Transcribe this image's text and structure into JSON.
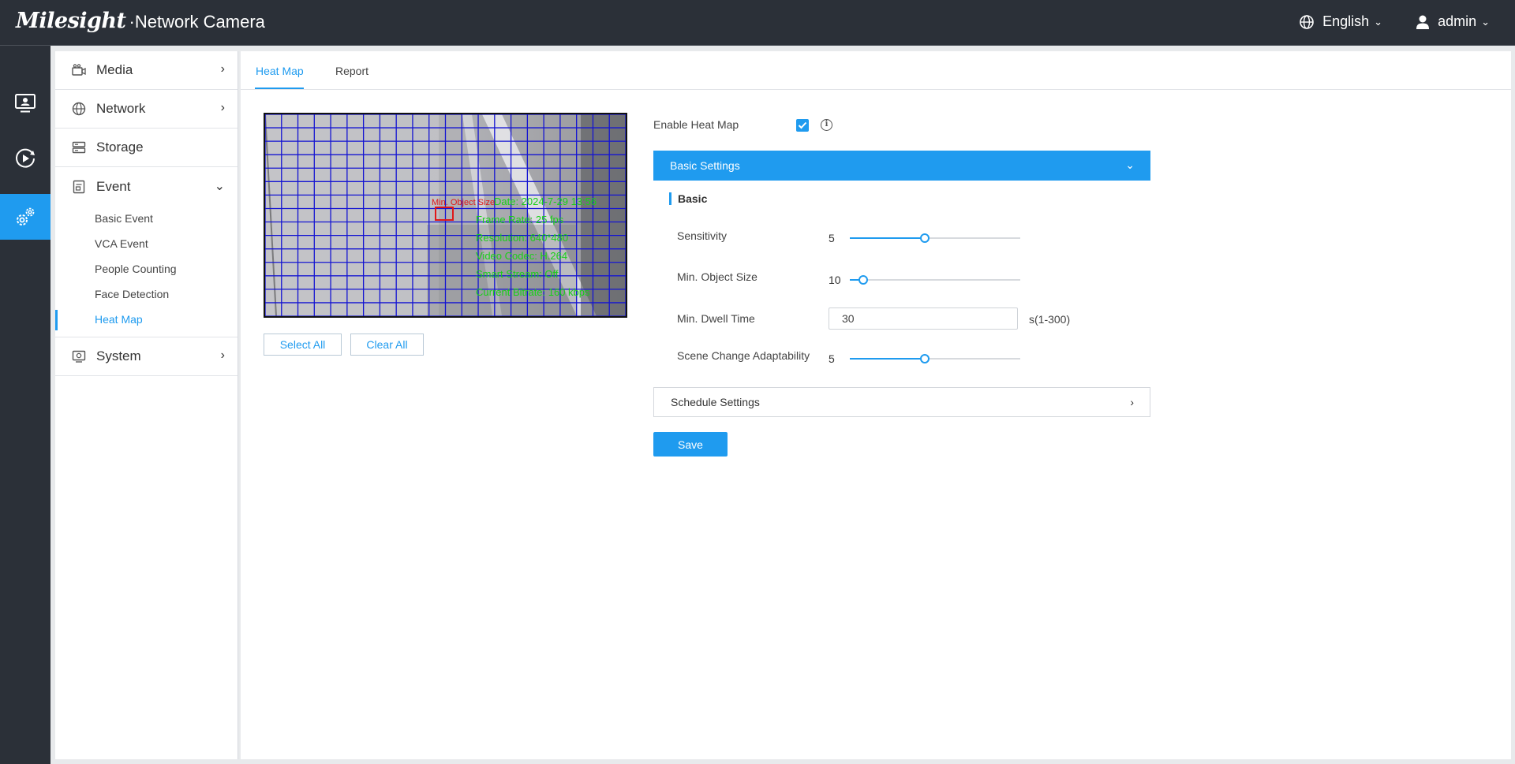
{
  "header": {
    "brand_logo": "Milesight",
    "brand_product": "·Network Camera",
    "language": "English",
    "user": "admin"
  },
  "rail": {
    "items": [
      {
        "icon": "live-view-icon"
      },
      {
        "icon": "playback-icon"
      },
      {
        "icon": "settings-icon",
        "active": true
      }
    ]
  },
  "sidebar": {
    "items": [
      {
        "label": "Media",
        "icon": "camera-icon"
      },
      {
        "label": "Network",
        "icon": "globe-icon"
      },
      {
        "label": "Storage",
        "icon": "storage-icon"
      },
      {
        "label": "Event",
        "icon": "event-icon",
        "expanded": true
      },
      {
        "label": "System",
        "icon": "system-icon"
      }
    ],
    "event_subitems": [
      {
        "label": "Basic Event"
      },
      {
        "label": "VCA Event"
      },
      {
        "label": "People Counting"
      },
      {
        "label": "Face Detection"
      },
      {
        "label": "Heat Map",
        "active": true
      }
    ]
  },
  "tabs": [
    {
      "label": "Heat Map",
      "active": true
    },
    {
      "label": "Report"
    }
  ],
  "video": {
    "min_object_label": "Min. Object Size",
    "osd_lines": [
      "Date: 2024-7-29 13:56",
      "Frame Rate: 25 fps",
      "Resolution: 640*480",
      "Video Codec: H.264",
      "Smart Stream: Off",
      "Current Bitrate: 160 kbps"
    ],
    "grid_color": "#1414d2",
    "osd_color": "#18d018"
  },
  "buttons": {
    "select_all": "Select All",
    "clear_all": "Clear All",
    "save": "Save"
  },
  "settings": {
    "enable_label": "Enable Heat Map",
    "enable_checked": true,
    "basic_settings": "Basic Settings",
    "basic_section": "Basic",
    "sensitivity": {
      "label": "Sensitivity",
      "value": "5",
      "level": 0.44
    },
    "min_object_size": {
      "label": "Min. Object Size",
      "value": "10",
      "level": 0.08
    },
    "min_dwell_time": {
      "label": "Min. Dwell Time",
      "value": "30",
      "unit": "s(1-300)"
    },
    "scene_change": {
      "label": "Scene Change Adaptability",
      "value": "5",
      "level": 0.44
    },
    "schedule_settings": "Schedule Settings"
  },
  "colors": {
    "accent": "#1f9bef",
    "topbar": "#2b3038"
  }
}
